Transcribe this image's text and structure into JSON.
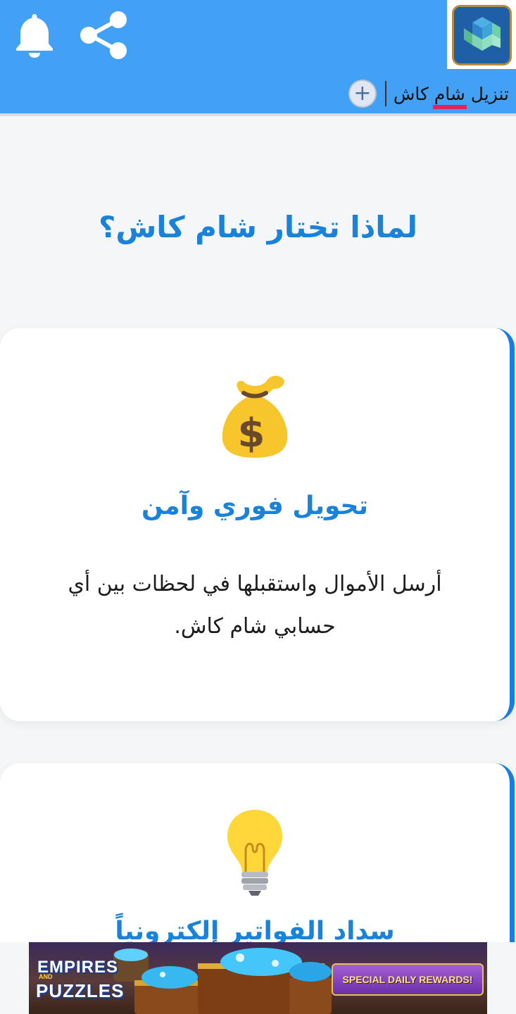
{
  "header": {
    "app_title_prefix": "تنزيل ",
    "app_title_highlight": "شام",
    "app_title_suffix": " كاش",
    "bell_icon": "bell-icon",
    "share_icon": "share-icon",
    "add_icon": "plus-circle-icon",
    "background_color": "#42a0f5",
    "highlight_color": "#e3245a"
  },
  "main": {
    "section_title": "لماذا تختار شام كاش؟",
    "accent_color": "#1a82d8",
    "cards": [
      {
        "icon": "money-bag-icon",
        "title": "تحويل فوري وآمن",
        "text": "أرسل الأموال واستقبلها في لحظات بين أي حسابي شام كاش."
      },
      {
        "icon": "light-bulb-icon",
        "title": "سداد الفواتير إلكترونياً",
        "text": ""
      }
    ]
  },
  "ad": {
    "brand_line1": "EMPIRES",
    "brand_and": "AND",
    "brand_line2": "PUZZLES",
    "banner_text": "SPECIAL DAILY REWARDS!"
  }
}
